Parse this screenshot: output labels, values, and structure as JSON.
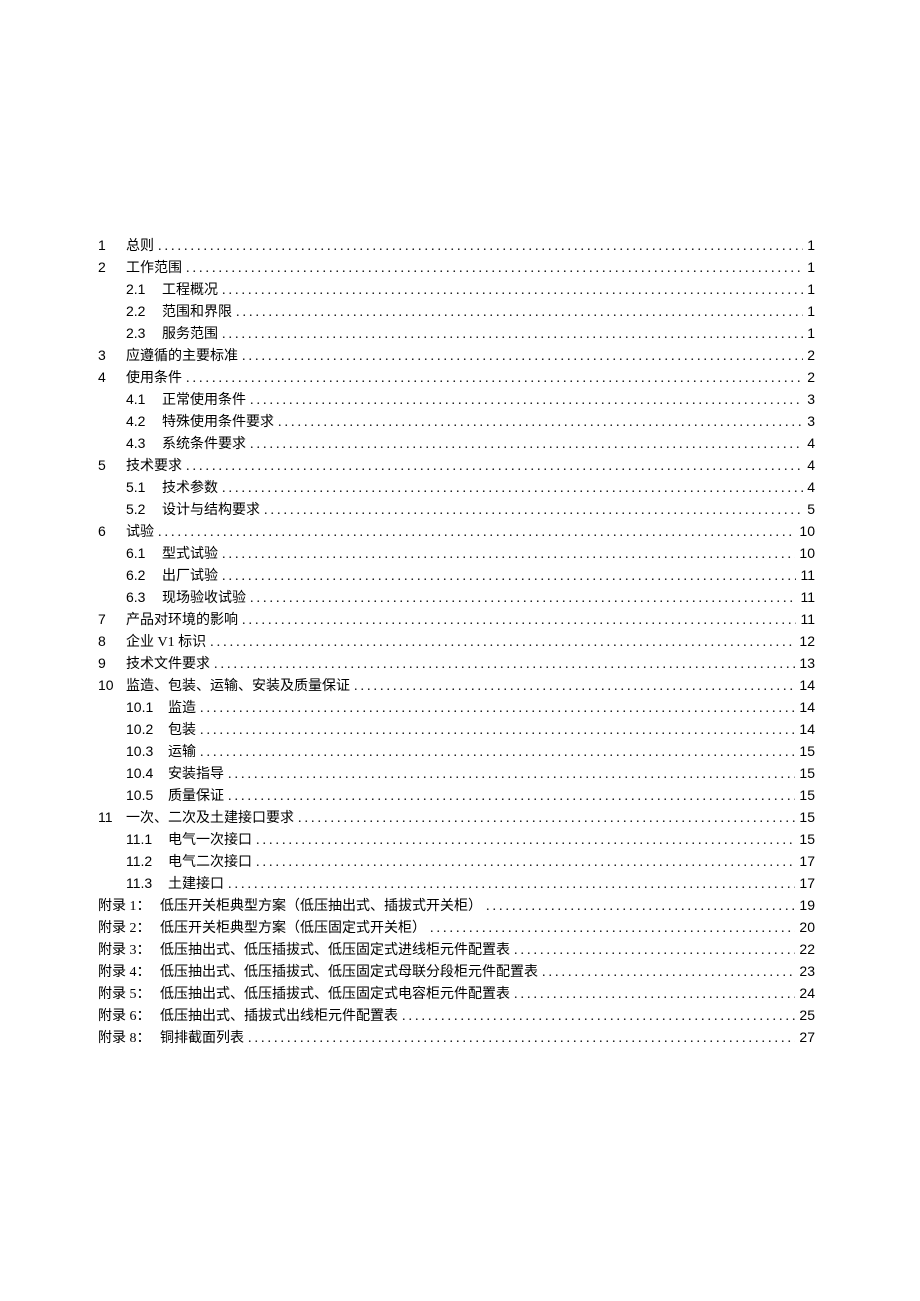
{
  "toc": [
    {
      "type": "l1",
      "num": "1",
      "title": "总则",
      "page": "1"
    },
    {
      "type": "l1",
      "num": "2",
      "title": "工作范围",
      "page": "1"
    },
    {
      "type": "l2",
      "num": "2.1",
      "title": "工程概况",
      "page": "1"
    },
    {
      "type": "l2",
      "num": "2.2",
      "title": "范围和界限",
      "page": "1"
    },
    {
      "type": "l2",
      "num": "2.3",
      "title": "服务范围",
      "page": "1"
    },
    {
      "type": "l1",
      "num": "3",
      "title": "应遵循的主要标准",
      "page": "2"
    },
    {
      "type": "l1",
      "num": "4",
      "title": "使用条件",
      "page": "2"
    },
    {
      "type": "l2",
      "num": "4.1",
      "title": "正常使用条件",
      "page": "3"
    },
    {
      "type": "l2",
      "num": "4.2",
      "title": "特殊使用条件要求",
      "page": "3"
    },
    {
      "type": "l2",
      "num": "4.3",
      "title": "系统条件要求",
      "page": "4"
    },
    {
      "type": "l1",
      "num": "5",
      "title": "技术要求",
      "page": "4"
    },
    {
      "type": "l2",
      "num": "5.1",
      "title": "技术参数",
      "page": "4"
    },
    {
      "type": "l2",
      "num": "5.2",
      "title": "设计与结构要求",
      "page": "5"
    },
    {
      "type": "l1",
      "num": "6",
      "title": "试验",
      "page": "10"
    },
    {
      "type": "l2",
      "num": "6.1",
      "title": "型式试验",
      "page": "10"
    },
    {
      "type": "l2",
      "num": "6.2",
      "title": "出厂试验",
      "page": "11"
    },
    {
      "type": "l2",
      "num": "6.3",
      "title": "现场验收试验",
      "page": "11"
    },
    {
      "type": "l1",
      "num": "7",
      "title": "产品对环境的影响",
      "page": "11"
    },
    {
      "type": "l1",
      "num": "8",
      "title": "企业 V1 标识",
      "page": "12"
    },
    {
      "type": "l1",
      "num": "9",
      "title": "技术文件要求",
      "page": "13"
    },
    {
      "type": "l1w",
      "num": "10",
      "title": "监造、包装、运输、安装及质量保证",
      "page": "14"
    },
    {
      "type": "l2w",
      "num": "10.1",
      "title": "监造",
      "page": "14"
    },
    {
      "type": "l2w",
      "num": "10.2",
      "title": "包装",
      "page": "14"
    },
    {
      "type": "l2w",
      "num": "10.3",
      "title": "运输",
      "page": "15"
    },
    {
      "type": "l2w",
      "num": "10.4",
      "title": "安装指导",
      "page": "15"
    },
    {
      "type": "l2w",
      "num": "10.5",
      "title": "质量保证",
      "page": "15"
    },
    {
      "type": "l1w",
      "num": "11",
      "title": "一次、二次及土建接口要求",
      "page": "15"
    },
    {
      "type": "l2w",
      "num": "11.1",
      "title": "电气一次接口",
      "page": "15"
    },
    {
      "type": "l2w",
      "num": "11.2",
      "title": "电气二次接口",
      "page": "17"
    },
    {
      "type": "l2w",
      "num": "11.3",
      "title": "土建接口",
      "page": "17"
    },
    {
      "type": "ap",
      "num": "附录 1：",
      "title": "低压开关柜典型方案（低压抽出式、插拔式开关柜）",
      "page": "19"
    },
    {
      "type": "ap",
      "num": "附录 2：",
      "title": "低压开关柜典型方案（低压固定式开关柜）",
      "page": "20"
    },
    {
      "type": "ap",
      "num": "附录 3：",
      "title": "低压抽出式、低压插拔式、低压固定式进线柜元件配置表",
      "page": "22"
    },
    {
      "type": "ap",
      "num": "附录 4：",
      "title": "低压抽出式、低压插拔式、低压固定式母联分段柜元件配置表",
      "page": "23"
    },
    {
      "type": "ap",
      "num": "附录 5：",
      "title": "低压抽出式、低压插拔式、低压固定式电容柜元件配置表",
      "page": "24"
    },
    {
      "type": "ap",
      "num": "附录 6：",
      "title": "低压抽出式、插拔式出线柜元件配置表",
      "page": "25"
    },
    {
      "type": "ap",
      "num": "附录 8：",
      "title": "铜排截面列表",
      "page": "27"
    }
  ]
}
